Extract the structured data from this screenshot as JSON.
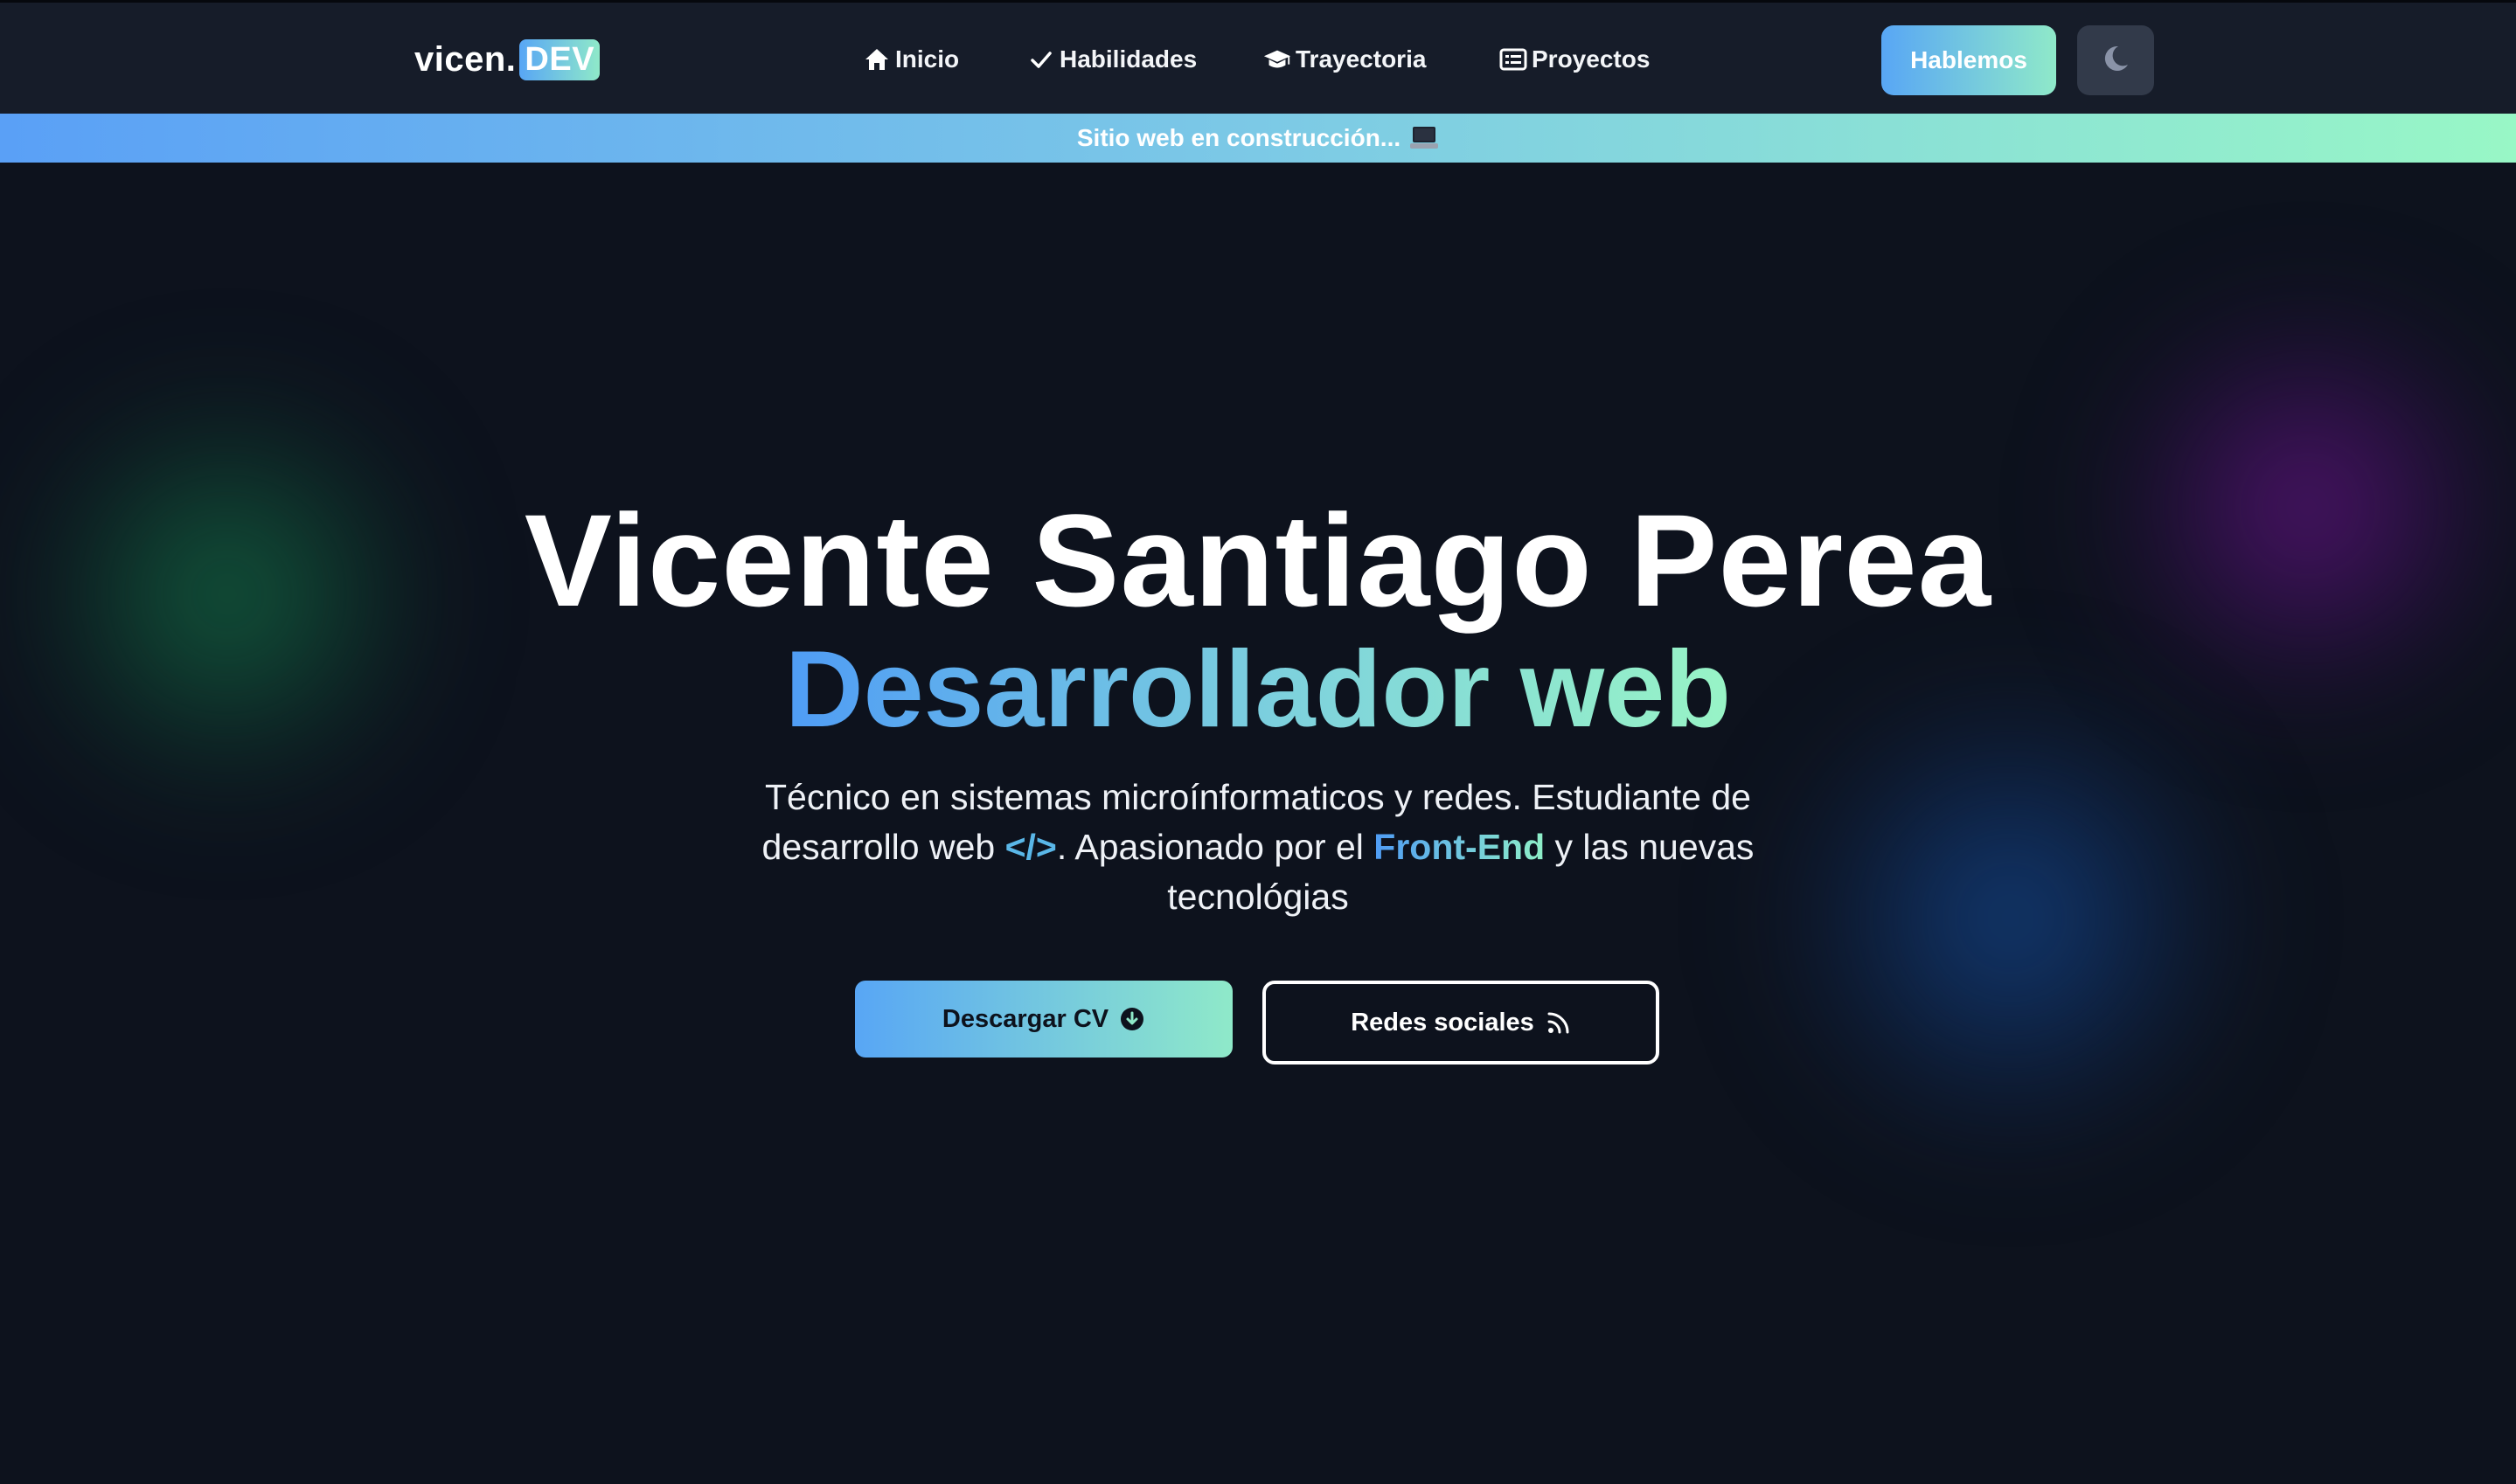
{
  "header": {
    "logo_text": "vicen.",
    "logo_badge": "DEV",
    "nav": [
      {
        "label": "Inicio",
        "icon": "home-icon"
      },
      {
        "label": "Habilidades",
        "icon": "check-icon"
      },
      {
        "label": "Trayectoria",
        "icon": "graduation-cap-icon"
      },
      {
        "label": "Proyectos",
        "icon": "list-alt-icon"
      }
    ],
    "cta_label": "Hablemos",
    "theme_toggle_icon": "moon-icon"
  },
  "banner": {
    "text": "Sitio web en construcción...",
    "icon": "laptop-icon"
  },
  "hero": {
    "name": "Vicente Santiago Perea",
    "role": "Desarrollador web",
    "desc_part1": "Técnico en sistemas microínformaticos y redes. Estudiante de desarrollo web ",
    "desc_code_tag": "</>",
    "desc_part2": ". Apasionado por el ",
    "desc_accent": "Front-End",
    "desc_part3": " y las nuevas tecnológias",
    "cv_button_label": "Descargar CV",
    "cv_button_icon": "download-circle-icon",
    "social_button_label": "Redes sociales",
    "social_button_icon": "rss-icon"
  },
  "colors": {
    "background": "#0d121d",
    "header_bg": "#161c29",
    "gradient_start": "#58a6f5",
    "gradient_end": "#8fe9c9",
    "theme_button_bg": "#323a4a"
  }
}
